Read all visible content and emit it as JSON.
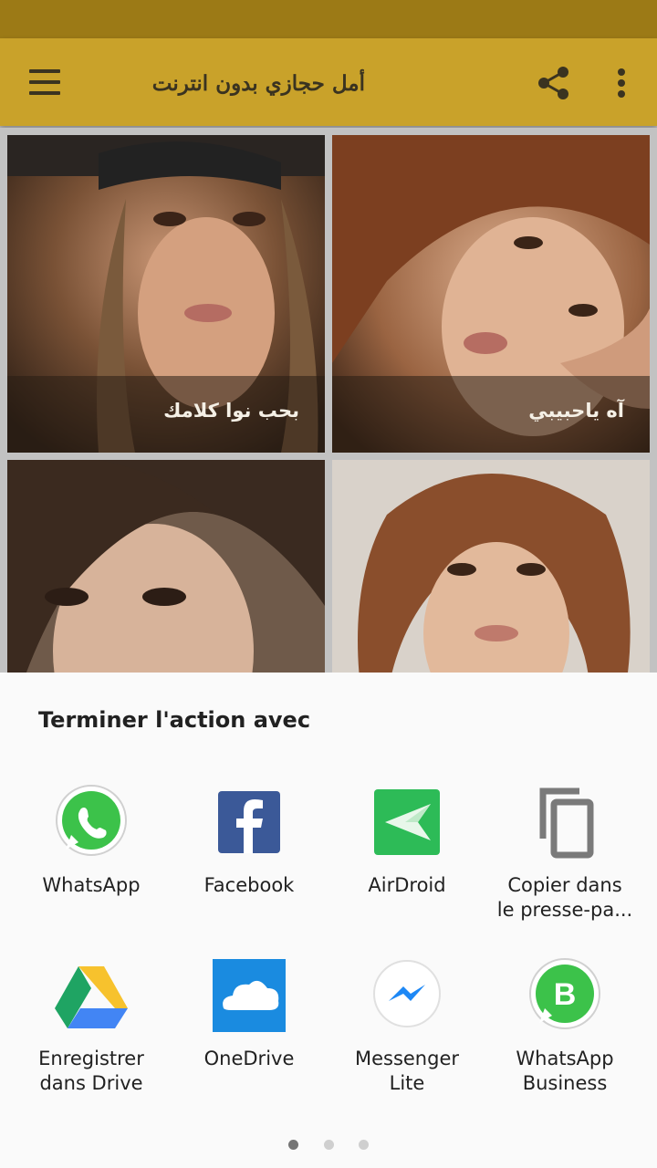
{
  "appbar": {
    "title": "أمل حجازي بدون انترنت",
    "menu_icon": "hamburger-menu-icon",
    "share_icon": "share-icon",
    "more_icon": "more-vert-icon",
    "colors": {
      "status": "#9c7a16",
      "bar": "#c9a22a"
    }
  },
  "grid": {
    "items": [
      {
        "caption": "بحب نوا كلامك"
      },
      {
        "caption": "آه ياحبيبي"
      },
      {
        "caption": ""
      },
      {
        "caption": ""
      }
    ]
  },
  "share_sheet": {
    "title": "Terminer l'action avec",
    "apps": [
      {
        "label": "WhatsApp",
        "icon": "whatsapp-icon"
      },
      {
        "label": "Facebook",
        "icon": "facebook-icon"
      },
      {
        "label": "AirDroid",
        "icon": "airdroid-icon"
      },
      {
        "label": "Copier dans\nle presse-pa...",
        "icon": "copy-icon"
      },
      {
        "label": "Enregistrer\ndans Drive",
        "icon": "google-drive-icon"
      },
      {
        "label": "OneDrive",
        "icon": "onedrive-icon"
      },
      {
        "label": "Messenger\nLite",
        "icon": "messenger-lite-icon"
      },
      {
        "label": "WhatsApp\nBusiness",
        "icon": "whatsapp-business-icon"
      }
    ],
    "page_count": 3,
    "current_page": 1
  }
}
